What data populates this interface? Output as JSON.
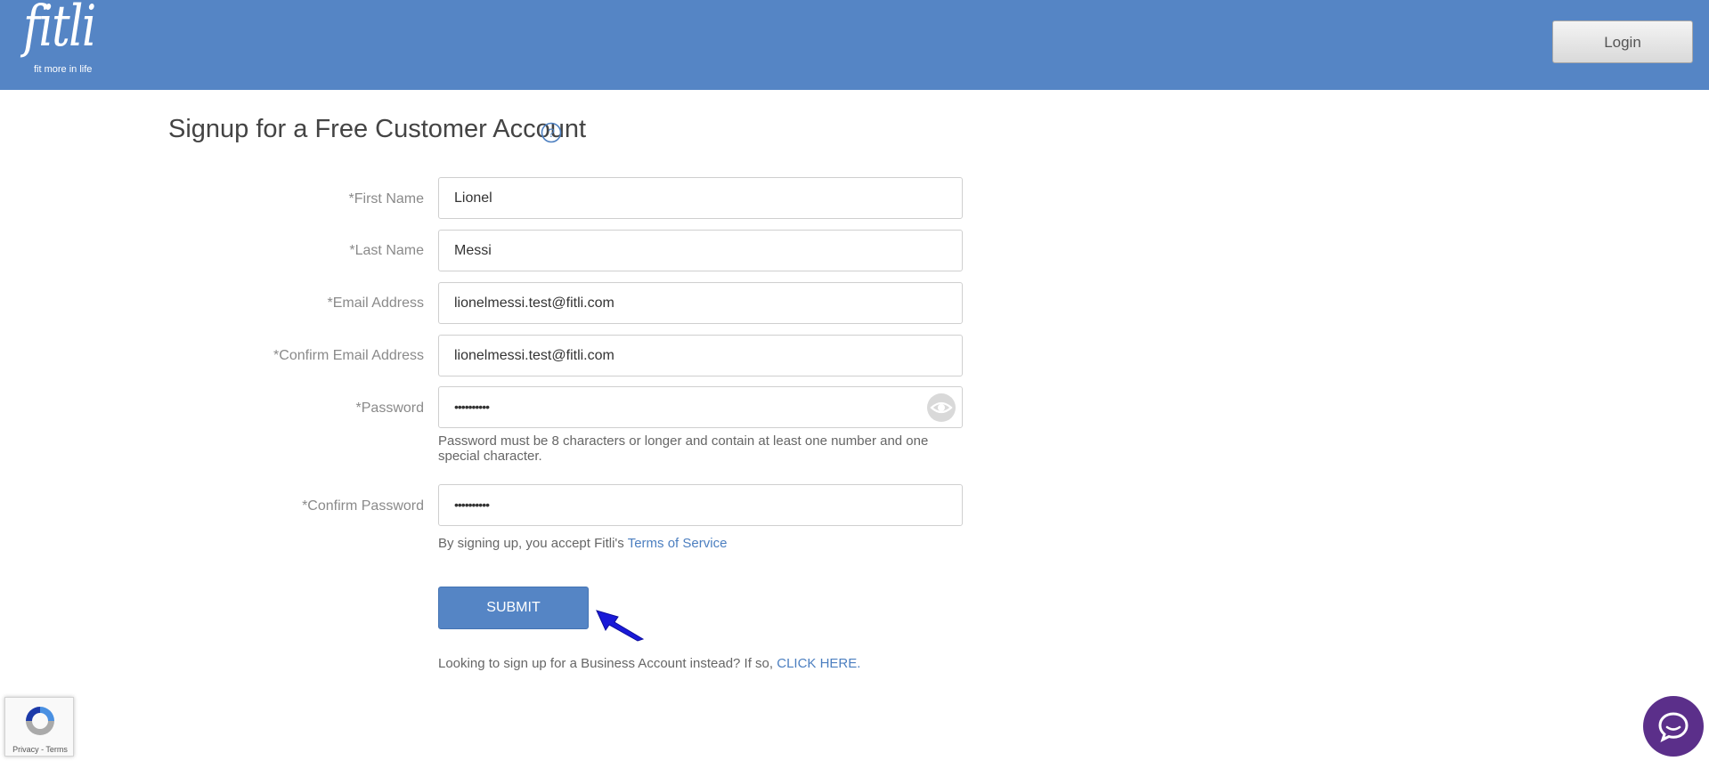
{
  "header": {
    "logo": {
      "wordmark": "fitli",
      "tagline": "fit more in life"
    },
    "login_label": "Login"
  },
  "page": {
    "title": "Signup for a Free Customer Account"
  },
  "form": {
    "first_name": {
      "label": "*First Name",
      "value": "Lionel"
    },
    "last_name": {
      "label": "*Last Name",
      "value": "Messi"
    },
    "email": {
      "label": "*Email Address",
      "value": "lionelmessi.test@fitli.com"
    },
    "confirm_email": {
      "label": "*Confirm Email Address",
      "value": "lionelmessi.test@fitli.com"
    },
    "password": {
      "label": "*Password",
      "value": "••••••••••"
    },
    "password_hint": "Password must be 8 characters or longer and contain at least one number and one special character.",
    "confirm_password": {
      "label": "*Confirm Password",
      "value": "••••••••••"
    },
    "terms_prefix": "By signing up, you accept Fitli's",
    "terms_link": "Terms of Service",
    "submit_label": "SUBMIT",
    "business_prefix": "Looking to sign up for a Business Account instead? If so,",
    "business_link": "CLICK HERE."
  },
  "recaptcha": {
    "links": "Privacy - Terms"
  },
  "colors": {
    "header_bg": "#5585c5",
    "accent": "#5585c5",
    "link": "#4c7fc0",
    "chat_bg": "#5b2f8a",
    "annotation_arrow": "#1a1ad8"
  },
  "icons": {
    "help": "help-circle-icon",
    "password_toggle": "eye-icon",
    "recaptcha": "recaptcha-icon",
    "chat": "chat-bubble-icon",
    "annotation": "arrow-icon"
  }
}
